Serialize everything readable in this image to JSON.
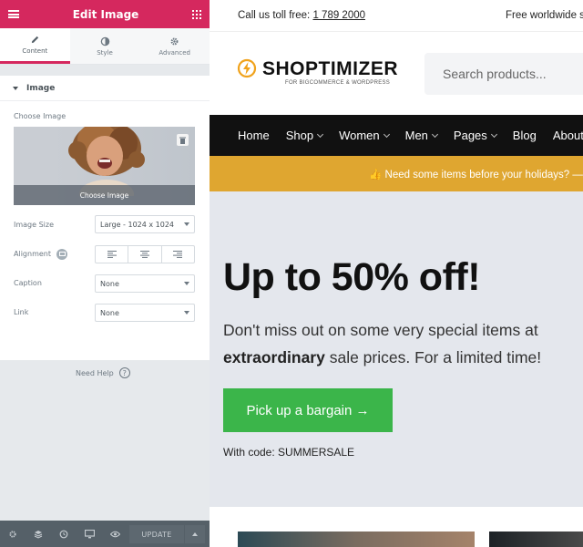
{
  "editor": {
    "header_title": "Edit Image",
    "tabs": [
      {
        "label": "Content",
        "icon": "pencil-icon",
        "active": true
      },
      {
        "label": "Style",
        "icon": "contrast-icon",
        "active": false
      },
      {
        "label": "Advanced",
        "icon": "gear-icon",
        "active": false
      }
    ],
    "section_title": "Image",
    "choose_image_label": "Choose Image",
    "choose_image_overlay": "Choose Image",
    "image_size_label": "Image Size",
    "image_size_value": "Large - 1024 x 1024",
    "alignment_label": "Alignment",
    "caption_label": "Caption",
    "caption_value": "None",
    "link_label": "Link",
    "link_value": "None",
    "need_help": "Need Help",
    "update_label": "UPDATE",
    "accent_color": "#d5285e"
  },
  "site": {
    "call_prefix": "Call us toll free: ",
    "phone": "1 789 2000",
    "shipping": "Free worldwide s",
    "logo_text": "SHOPTIMIZER",
    "logo_tagline": "FOR BIGCOMMERCE & WORDPRESS",
    "search_placeholder": "Search products...",
    "nav": [
      {
        "label": "Home",
        "dropdown": false
      },
      {
        "label": "Shop",
        "dropdown": true
      },
      {
        "label": "Women",
        "dropdown": true
      },
      {
        "label": "Men",
        "dropdown": true
      },
      {
        "label": "Pages",
        "dropdown": true
      },
      {
        "label": "Blog",
        "dropdown": false
      },
      {
        "label": "About",
        "dropdown": false
      }
    ],
    "promo_text": "👍 Need some items before your holidays? — ",
    "hero_title": "Up to 50% off!",
    "hero_sub_1": "Don't miss out on some very special items at ",
    "hero_sub_bold": "extraordinary",
    "hero_sub_2": " sale prices. For a limited time!",
    "cta_label": "Pick up a bargain →",
    "code_text": "With code: SUMMERSALE",
    "promo_color": "#dfa630",
    "cta_color": "#3bb54a"
  }
}
